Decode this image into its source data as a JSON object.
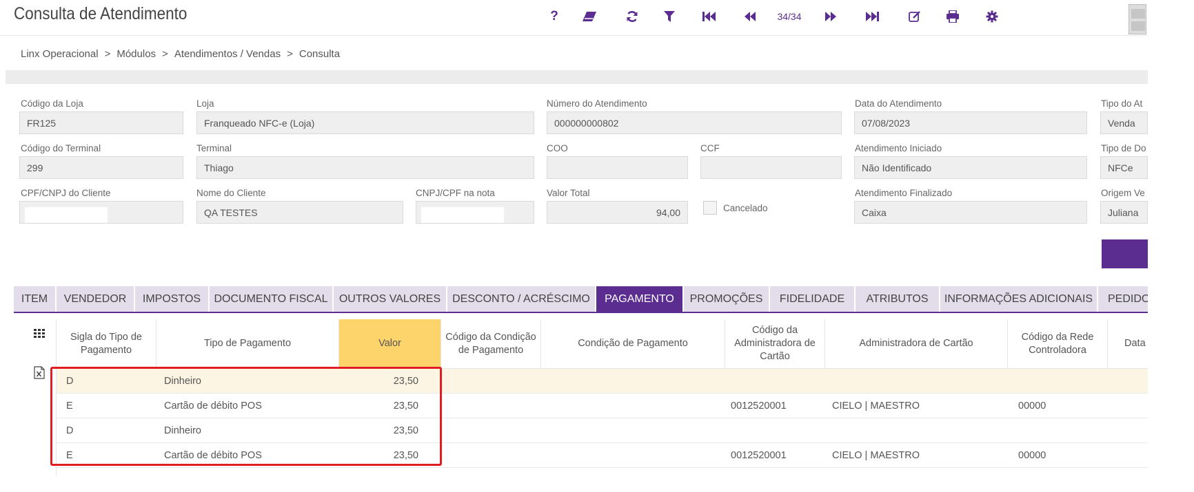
{
  "header": {
    "title": "Consulta de Atendimento",
    "record_counter": "34/34",
    "toolbar_icons": [
      "help-icon",
      "eraser-icon",
      "refresh-icon",
      "filter-icon",
      "first-record-icon",
      "previous-record-icon",
      "next-record-icon",
      "last-record-icon",
      "edit-icon",
      "print-icon",
      "settings-icon"
    ],
    "help_label": "?"
  },
  "breadcrumb": [
    "Linx Operacional",
    "Módulos",
    "Atendimentos / Vendas",
    "Consulta"
  ],
  "breadcrumb_separator": ">",
  "form": {
    "codigo_loja": {
      "label": "Código da Loja",
      "value": "FR125"
    },
    "loja": {
      "label": "Loja",
      "value": "Franqueado NFC-e (Loja)"
    },
    "numero_atendimento": {
      "label": "Número do Atendimento",
      "value": "000000000802"
    },
    "data_atendimento": {
      "label": "Data do Atendimento",
      "value": "07/08/2023"
    },
    "tipo_atendimento": {
      "label": "Tipo do At",
      "value": "Venda"
    },
    "codigo_terminal": {
      "label": "Código do Terminal",
      "value": "299"
    },
    "terminal": {
      "label": "Terminal",
      "value": "Thiago"
    },
    "coo": {
      "label": "COO",
      "value": ""
    },
    "ccf": {
      "label": "CCF",
      "value": ""
    },
    "atendimento_iniciado": {
      "label": "Atendimento Iniciado",
      "value": "Não Identificado"
    },
    "tipo_documento": {
      "label": "Tipo de Do",
      "value": "NFCe"
    },
    "cpf_cliente": {
      "label": "CPF/CNPJ do Cliente",
      "value": ""
    },
    "nome_cliente": {
      "label": "Nome do Cliente",
      "value": "QA TESTES"
    },
    "cpf_nota": {
      "label": "CNPJ/CPF na nota",
      "value": ""
    },
    "valor_total": {
      "label": "Valor Total",
      "value": "94,00"
    },
    "cancelado": {
      "label": "Cancelado",
      "checked": false
    },
    "atendimento_finalizado": {
      "label": "Atendimento Finalizado",
      "value": "Caixa"
    },
    "origem_venda": {
      "label": "Origem Ve",
      "value": "Juliana"
    }
  },
  "tabs": [
    "ITEM",
    "VENDEDOR",
    "IMPOSTOS",
    "DOCUMENTO FISCAL",
    "OUTROS VALORES",
    "DESCONTO / ACRÉSCIMO",
    "PAGAMENTO",
    "PROMOÇÕES",
    "FIDELIDADE",
    "ATRIBUTOS",
    "INFORMAÇÕES ADICIONAIS",
    "PEDIDOS C"
  ],
  "active_tab": "PAGAMENTO",
  "table": {
    "columns": [
      "Sigla do Tipo de Pagamento",
      "Tipo de Pagamento",
      "Valor",
      "Código da Condição de Pagamento",
      "Condição de Pagamento",
      "Código da Administradora de Cartão",
      "Administradora de Cartão",
      "Código da Rede Controladora",
      "Data"
    ],
    "rows": [
      {
        "sigla": "D",
        "tipo": "Dinheiro",
        "valor": "23,50",
        "cod_condicao": "",
        "condicao": "",
        "cod_admin": "",
        "admin": "",
        "cod_rede": ""
      },
      {
        "sigla": "E",
        "tipo": "Cartão de débito POS",
        "valor": "23,50",
        "cod_condicao": "",
        "condicao": "",
        "cod_admin": "0012520001",
        "admin": "CIELO | MAESTRO",
        "cod_rede": "00000"
      },
      {
        "sigla": "D",
        "tipo": "Dinheiro",
        "valor": "23,50",
        "cod_condicao": "",
        "condicao": "",
        "cod_admin": "",
        "admin": "",
        "cod_rede": ""
      },
      {
        "sigla": "E",
        "tipo": "Cartão de débito POS",
        "valor": "23,50",
        "cod_condicao": "",
        "condicao": "",
        "cod_admin": "0012520001",
        "admin": "CIELO | MAESTRO",
        "cod_rede": "00000"
      }
    ]
  },
  "colors": {
    "accent": "#5b2d90",
    "highlight_column": "#fdd36b",
    "annotation_box": "#e11d24"
  }
}
